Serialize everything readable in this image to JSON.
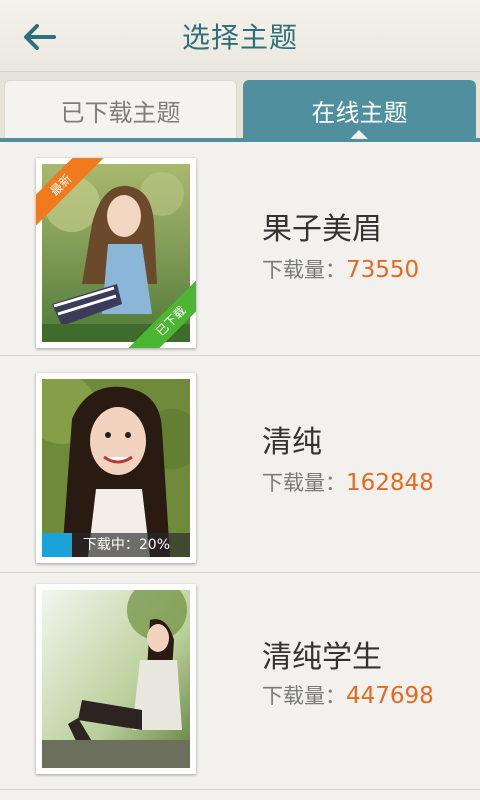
{
  "header": {
    "title": "选择主题",
    "back_icon": "back-arrow-icon"
  },
  "tabs": [
    {
      "label": "已下载主题",
      "active": false
    },
    {
      "label": "在线主题",
      "active": true
    }
  ],
  "colors": {
    "accent": "#4f8f9e",
    "title": "#2f6f7c",
    "count": "#e56a1e",
    "progress": "#1aa3d9",
    "new_badge": "#f07a1c",
    "downloaded_badge": "#4cb531"
  },
  "themes": [
    {
      "name": "果子美眉",
      "download_label": "下载量：",
      "download_count": "73550",
      "new_badge": "最新",
      "downloaded_badge": "已下载"
    },
    {
      "name": "清纯",
      "download_label": "下载量：",
      "download_count": "162848",
      "progress_text": "下载中：20%",
      "progress": 0.2
    },
    {
      "name": "清纯学生",
      "download_label": "下载量：",
      "download_count": "447698"
    }
  ]
}
